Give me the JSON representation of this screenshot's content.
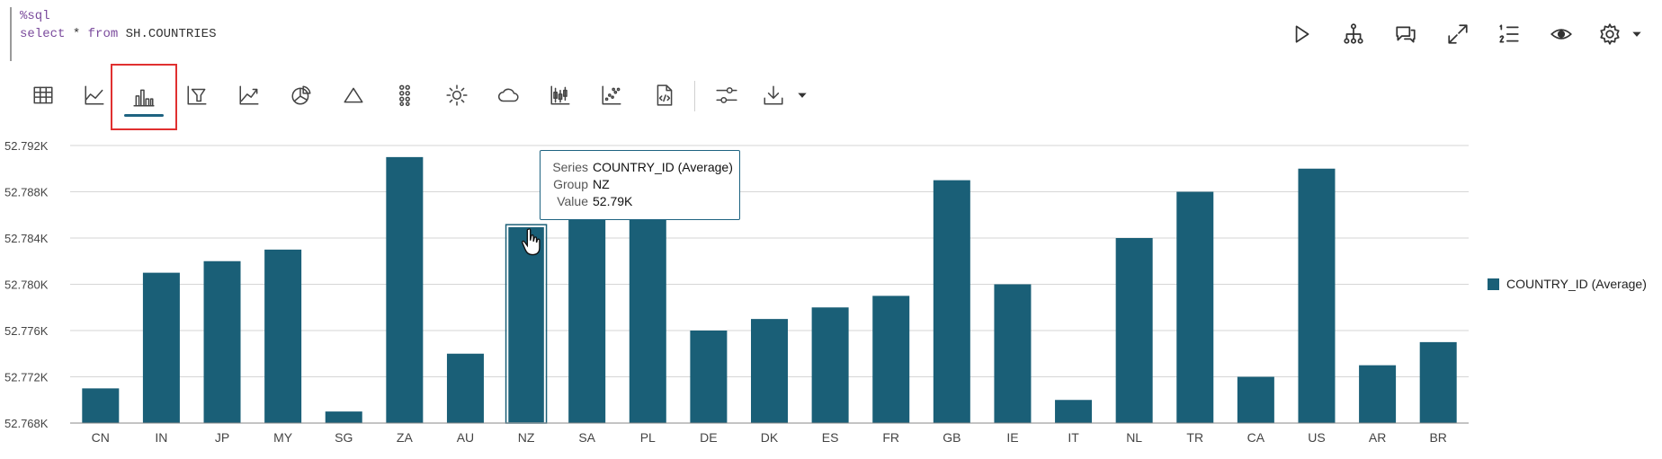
{
  "editor": {
    "line1": "%sql",
    "line2_kw1": "select",
    "line2_mid": " * ",
    "line2_kw2": "from",
    "line2_rest": " SH.COUNTRIES"
  },
  "toolbar_icons": [
    "run-icon",
    "explain-plan-icon",
    "comments-icon",
    "expand-icon",
    "list-icon",
    "visibility-icon",
    "settings-icon",
    "caret-down-icon"
  ],
  "viz_tabs": [
    "table-icon",
    "line-chart-icon",
    "bar-chart-icon",
    "funnel-icon",
    "area-chart-icon",
    "pie-chart-icon",
    "pyramid-icon",
    "grid-dots-icon",
    "sunburst-icon",
    "cloud-icon",
    "box-plot-icon",
    "scatter-icon",
    "code-file-icon",
    "settings-sliders-icon",
    "download-icon",
    "caret-down-icon"
  ],
  "active_tab": "bar-chart-icon",
  "tooltip": {
    "series_label": "Series",
    "series_value": "COUNTRY_ID (Average)",
    "group_label": "Group",
    "group_value": "NZ",
    "value_label": "Value",
    "value_value": "52.79K"
  },
  "colors": {
    "bar": "#1a5f77",
    "accent": "#1e6381",
    "highlight_border": "#e03030"
  },
  "chart_data": {
    "type": "bar",
    "categories": [
      "CN",
      "IN",
      "JP",
      "MY",
      "SG",
      "ZA",
      "AU",
      "NZ",
      "SA",
      "PL",
      "DE",
      "DK",
      "ES",
      "FR",
      "GB",
      "IE",
      "IT",
      "NL",
      "TR",
      "CA",
      "US",
      "AR",
      "BR"
    ],
    "series": [
      {
        "name": "COUNTRY_ID (Average)",
        "values": [
          52771,
          52781,
          52782,
          52783,
          52769,
          52791,
          52774,
          52785,
          52786,
          52786,
          52776,
          52777,
          52778,
          52779,
          52789,
          52780,
          52770,
          52784,
          52788,
          52772,
          52790,
          52773,
          52775
        ]
      }
    ],
    "ylim": [
      52768,
      52792
    ],
    "yticks": [
      {
        "value": 52768,
        "label": "52.768K"
      },
      {
        "value": 52772,
        "label": "52.772K"
      },
      {
        "value": 52776,
        "label": "52.776K"
      },
      {
        "value": 52780,
        "label": "52.780K"
      },
      {
        "value": 52784,
        "label": "52.784K"
      },
      {
        "value": 52788,
        "label": "52.788K"
      },
      {
        "value": 52792,
        "label": "52.792K"
      }
    ],
    "highlighted_category": "NZ",
    "grid": true,
    "legend_position": "right"
  },
  "legend": {
    "label": "COUNTRY_ID (Average)"
  }
}
